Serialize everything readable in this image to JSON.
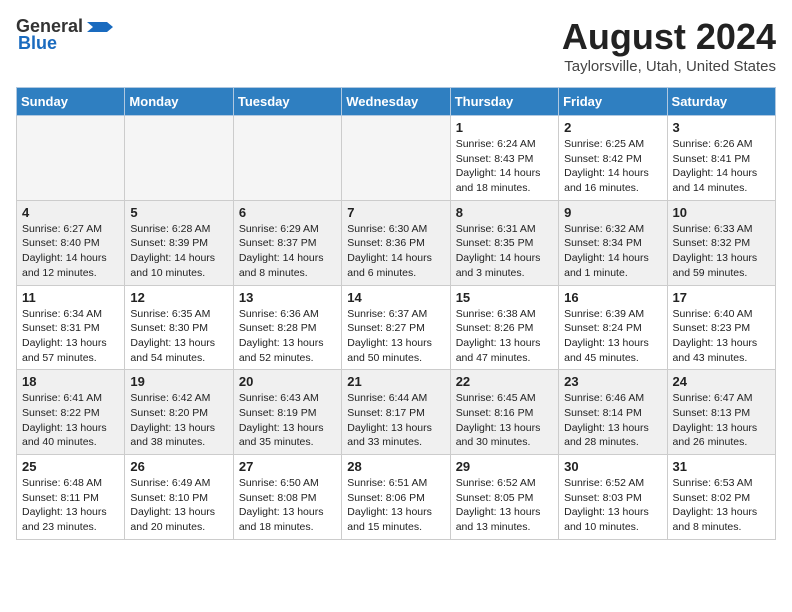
{
  "header": {
    "logo_general": "General",
    "logo_blue": "Blue",
    "month_year": "August 2024",
    "location": "Taylorsville, Utah, United States"
  },
  "days_of_week": [
    "Sunday",
    "Monday",
    "Tuesday",
    "Wednesday",
    "Thursday",
    "Friday",
    "Saturday"
  ],
  "weeks": [
    [
      {
        "day": "",
        "text": ""
      },
      {
        "day": "",
        "text": ""
      },
      {
        "day": "",
        "text": ""
      },
      {
        "day": "",
        "text": ""
      },
      {
        "day": "1",
        "text": "Sunrise: 6:24 AM\nSunset: 8:43 PM\nDaylight: 14 hours\nand 18 minutes."
      },
      {
        "day": "2",
        "text": "Sunrise: 6:25 AM\nSunset: 8:42 PM\nDaylight: 14 hours\nand 16 minutes."
      },
      {
        "day": "3",
        "text": "Sunrise: 6:26 AM\nSunset: 8:41 PM\nDaylight: 14 hours\nand 14 minutes."
      }
    ],
    [
      {
        "day": "4",
        "text": "Sunrise: 6:27 AM\nSunset: 8:40 PM\nDaylight: 14 hours\nand 12 minutes."
      },
      {
        "day": "5",
        "text": "Sunrise: 6:28 AM\nSunset: 8:39 PM\nDaylight: 14 hours\nand 10 minutes."
      },
      {
        "day": "6",
        "text": "Sunrise: 6:29 AM\nSunset: 8:37 PM\nDaylight: 14 hours\nand 8 minutes."
      },
      {
        "day": "7",
        "text": "Sunrise: 6:30 AM\nSunset: 8:36 PM\nDaylight: 14 hours\nand 6 minutes."
      },
      {
        "day": "8",
        "text": "Sunrise: 6:31 AM\nSunset: 8:35 PM\nDaylight: 14 hours\nand 3 minutes."
      },
      {
        "day": "9",
        "text": "Sunrise: 6:32 AM\nSunset: 8:34 PM\nDaylight: 14 hours\nand 1 minute."
      },
      {
        "day": "10",
        "text": "Sunrise: 6:33 AM\nSunset: 8:32 PM\nDaylight: 13 hours\nand 59 minutes."
      }
    ],
    [
      {
        "day": "11",
        "text": "Sunrise: 6:34 AM\nSunset: 8:31 PM\nDaylight: 13 hours\nand 57 minutes."
      },
      {
        "day": "12",
        "text": "Sunrise: 6:35 AM\nSunset: 8:30 PM\nDaylight: 13 hours\nand 54 minutes."
      },
      {
        "day": "13",
        "text": "Sunrise: 6:36 AM\nSunset: 8:28 PM\nDaylight: 13 hours\nand 52 minutes."
      },
      {
        "day": "14",
        "text": "Sunrise: 6:37 AM\nSunset: 8:27 PM\nDaylight: 13 hours\nand 50 minutes."
      },
      {
        "day": "15",
        "text": "Sunrise: 6:38 AM\nSunset: 8:26 PM\nDaylight: 13 hours\nand 47 minutes."
      },
      {
        "day": "16",
        "text": "Sunrise: 6:39 AM\nSunset: 8:24 PM\nDaylight: 13 hours\nand 45 minutes."
      },
      {
        "day": "17",
        "text": "Sunrise: 6:40 AM\nSunset: 8:23 PM\nDaylight: 13 hours\nand 43 minutes."
      }
    ],
    [
      {
        "day": "18",
        "text": "Sunrise: 6:41 AM\nSunset: 8:22 PM\nDaylight: 13 hours\nand 40 minutes."
      },
      {
        "day": "19",
        "text": "Sunrise: 6:42 AM\nSunset: 8:20 PM\nDaylight: 13 hours\nand 38 minutes."
      },
      {
        "day": "20",
        "text": "Sunrise: 6:43 AM\nSunset: 8:19 PM\nDaylight: 13 hours\nand 35 minutes."
      },
      {
        "day": "21",
        "text": "Sunrise: 6:44 AM\nSunset: 8:17 PM\nDaylight: 13 hours\nand 33 minutes."
      },
      {
        "day": "22",
        "text": "Sunrise: 6:45 AM\nSunset: 8:16 PM\nDaylight: 13 hours\nand 30 minutes."
      },
      {
        "day": "23",
        "text": "Sunrise: 6:46 AM\nSunset: 8:14 PM\nDaylight: 13 hours\nand 28 minutes."
      },
      {
        "day": "24",
        "text": "Sunrise: 6:47 AM\nSunset: 8:13 PM\nDaylight: 13 hours\nand 26 minutes."
      }
    ],
    [
      {
        "day": "25",
        "text": "Sunrise: 6:48 AM\nSunset: 8:11 PM\nDaylight: 13 hours\nand 23 minutes."
      },
      {
        "day": "26",
        "text": "Sunrise: 6:49 AM\nSunset: 8:10 PM\nDaylight: 13 hours\nand 20 minutes."
      },
      {
        "day": "27",
        "text": "Sunrise: 6:50 AM\nSunset: 8:08 PM\nDaylight: 13 hours\nand 18 minutes."
      },
      {
        "day": "28",
        "text": "Sunrise: 6:51 AM\nSunset: 8:06 PM\nDaylight: 13 hours\nand 15 minutes."
      },
      {
        "day": "29",
        "text": "Sunrise: 6:52 AM\nSunset: 8:05 PM\nDaylight: 13 hours\nand 13 minutes."
      },
      {
        "day": "30",
        "text": "Sunrise: 6:52 AM\nSunset: 8:03 PM\nDaylight: 13 hours\nand 10 minutes."
      },
      {
        "day": "31",
        "text": "Sunrise: 6:53 AM\nSunset: 8:02 PM\nDaylight: 13 hours\nand 8 minutes."
      }
    ]
  ]
}
